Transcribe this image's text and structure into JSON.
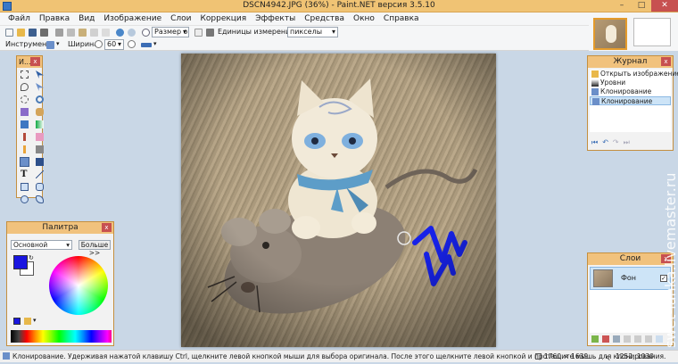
{
  "window": {
    "title": "DSCN4942.JPG (36%) - Paint.NET версия 3.5.10",
    "minimize": "–",
    "maximize": "□",
    "close": "✕"
  },
  "menu": [
    "Файл",
    "Правка",
    "Вид",
    "Изображение",
    "Слои",
    "Коррекция",
    "Эффекты",
    "Средства",
    "Окно",
    "Справка"
  ],
  "toolbar": {
    "zoom_label": "Размер ок",
    "units_label": "Единицы измерения:",
    "units_value": "пикселы"
  },
  "tool_options": {
    "tool_label": "Инструмент:",
    "width_label": "Ширина:",
    "width_value": "60"
  },
  "tools_panel": {
    "title": "И...",
    "close": "x"
  },
  "palette": {
    "title": "Палитра",
    "close": "x",
    "mode": "Основной",
    "more_button": "Больше >>",
    "primary_color": "#1a16e0",
    "secondary_color": "#ffffff"
  },
  "journal": {
    "title": "Журнал",
    "close": "x",
    "items": [
      "Открыть изображение",
      "Уровни",
      "Клонирование",
      "Клонирование"
    ]
  },
  "layers": {
    "title": "Слои",
    "close": "x",
    "items": [
      "Фон"
    ]
  },
  "status": {
    "message": "Клонирование. Удерживая нажатой клавишу Ctrl, щелкните левой кнопкой мыши для выбора оригинала. После этого щелкните левой кнопкой и протащите мышь для клонирования.",
    "size": "1760 ⨯ 1639",
    "position": "1252, 1030"
  },
  "watermark": "swet-lanka.livemaster.ru",
  "icons": {
    "tools": [
      "rectangle-select-icon",
      "move-icon",
      "lasso-icon",
      "move-selection-icon",
      "ellipse-select-icon",
      "zoom-icon",
      "magic-wand-icon",
      "pan-icon",
      "paint-bucket-icon",
      "gradient-icon",
      "paintbrush-icon",
      "eraser-icon",
      "pencil-icon",
      "color-picker-icon",
      "clone-stamp-icon",
      "recolor-icon",
      "text-icon",
      "line-icon",
      "rectangle-icon",
      "rounded-rectangle-icon",
      "ellipse-icon",
      "freeform-shape-icon"
    ]
  }
}
